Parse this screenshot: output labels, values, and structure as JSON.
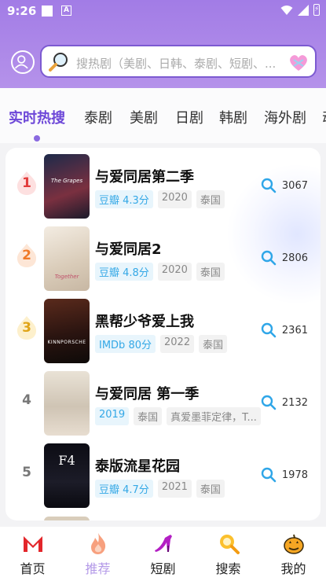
{
  "status": {
    "time": "9:26",
    "battery_glyph": "⚡"
  },
  "search": {
    "placeholder": "搜热剧（美剧、日韩、泰剧、短剧、..."
  },
  "tabs": [
    "实时热搜",
    "泰剧",
    "美剧",
    "日剧",
    "韩剧",
    "海外剧",
    "动"
  ],
  "active_tab": "实时热搜",
  "colors": {
    "accent": "#6d47d8",
    "header": "#a27ce6",
    "score": "#34a8e6"
  },
  "list": [
    {
      "rank": "1",
      "title": "与爱同居第二季",
      "tags": [
        "豆瓣 4.3分",
        "2020",
        "泰国"
      ],
      "hot": "3067",
      "poster_caption": "The Grapes"
    },
    {
      "rank": "2",
      "title": "与爱同居2",
      "tags": [
        "豆瓣 4.8分",
        "2020",
        "泰国"
      ],
      "hot": "2806",
      "poster_caption": "Together"
    },
    {
      "rank": "3",
      "title": "黑帮少爷爱上我",
      "tags": [
        "IMDb 80分",
        "2022",
        "泰国"
      ],
      "hot": "2361",
      "poster_caption": "KINNPORSCHE"
    },
    {
      "rank": "4",
      "title": "与爱同居 第一季",
      "tags": [
        "2019",
        "泰国",
        "真爱墨菲定律，T..."
      ],
      "hot": "2132",
      "poster_caption": ""
    },
    {
      "rank": "5",
      "title": "泰版流星花园",
      "tags": [
        "豆瓣 4.7分",
        "2021",
        "泰国"
      ],
      "hot": "1978",
      "poster_caption": "F4"
    }
  ],
  "nav": [
    {
      "label": "首页",
      "icon": "m-logo-icon"
    },
    {
      "label": "推荐",
      "icon": "flame-icon"
    },
    {
      "label": "短剧",
      "icon": "high-heel-icon"
    },
    {
      "label": "搜索",
      "icon": "search-icon"
    },
    {
      "label": "我的",
      "icon": "pumpkin-icon"
    }
  ],
  "active_nav": "推荐"
}
